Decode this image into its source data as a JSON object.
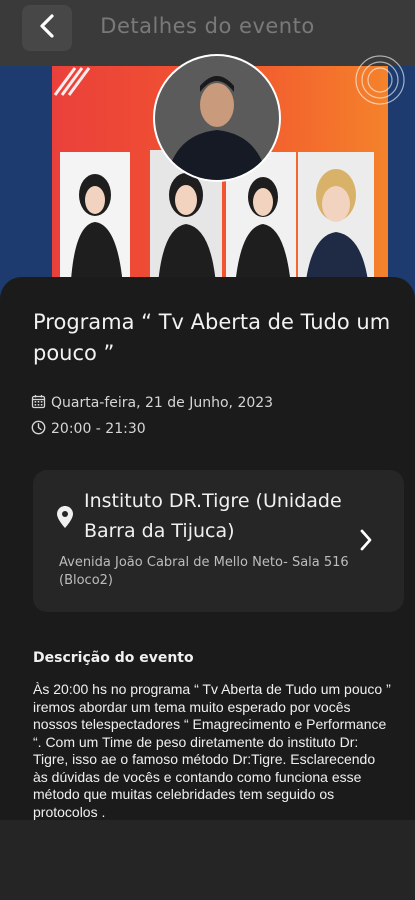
{
  "header": {
    "title": "Detalhes do evento",
    "back_icon": "chevron-left-icon"
  },
  "event": {
    "title": " Programa “ Tv Aberta de Tudo um pouco ”",
    "date": "Quarta-feira, 21 de Junho, 2023",
    "time": "20:00 - 21:30",
    "date_icon": "calendar-icon",
    "time_icon": "clock-icon"
  },
  "location": {
    "name": "Instituto DR.Tigre (Unidade Barra da Tijuca)",
    "address": "Avenida João Cabral de Mello Neto- Sala 516 (Bloco2)",
    "pin_icon": "map-pin-icon",
    "chevron_icon": "chevron-right-icon"
  },
  "description": {
    "heading": "Descrição do evento",
    "body": "Às 20:00 hs no programa “ Tv Aberta de Tudo um pouco ” iremos abordar um tema muito esperado por vocês nossos telespectadores “ Emagrecimento e Performance “. Com um Time de peso diretamente do instituto Dr: Tigre, isso ae o famoso método Dr:Tigre. Esclarecendo às dúvidas de vocês e contando como funciona esse método que muitas celebridades tem seguido os protocolos ."
  },
  "colors": {
    "background": "#252525",
    "card": "#1b1b1b",
    "location_card": "#262626",
    "banner_orange": "#f26b2a",
    "banner_red": "#e83a3f",
    "banner_blue": "#1d3b6e"
  }
}
